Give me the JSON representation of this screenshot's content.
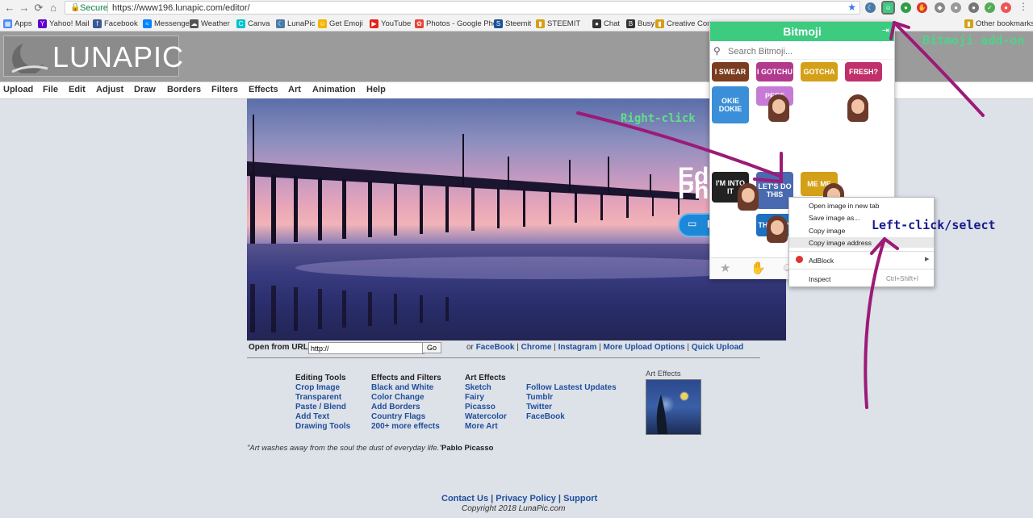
{
  "browser": {
    "nav": {
      "back": "←",
      "forward": "→",
      "reload": "⟳",
      "home": "⌂"
    },
    "secure_label": "Secure",
    "url": "https://www196.lunapic.com/editor/",
    "bookmarks": [
      {
        "label": "Apps",
        "color": "#4a8af4",
        "glyph": "▦"
      },
      {
        "label": "Yahoo! Mail",
        "color": "#5f01d1",
        "glyph": "Y"
      },
      {
        "label": "Facebook",
        "color": "#3b5998",
        "glyph": "f"
      },
      {
        "label": "Messenger",
        "color": "#0084ff",
        "glyph": "≈"
      },
      {
        "label": "Weather",
        "color": "#555",
        "glyph": "☁"
      },
      {
        "label": "Canva",
        "color": "#00c4cc",
        "glyph": "C"
      },
      {
        "label": "LunaPic",
        "color": "#4a7aa8",
        "glyph": "☾"
      },
      {
        "label": "Get Emoji",
        "color": "#f4b400",
        "glyph": "☺"
      },
      {
        "label": "YouTube",
        "color": "#e62117",
        "glyph": "▶"
      },
      {
        "label": "Photos - Google Pho",
        "color": "#ea4335",
        "glyph": "✿"
      },
      {
        "label": "Steemit",
        "color": "#1a5099",
        "glyph": "S"
      },
      {
        "label": "STEEMIT",
        "color": "#d4a017",
        "glyph": "▮"
      },
      {
        "label": "Chat",
        "color": "#333",
        "glyph": "●"
      },
      {
        "label": "Busy",
        "color": "#333",
        "glyph": "B"
      },
      {
        "label": "Creative Commons",
        "color": "#d4a017",
        "glyph": "▮"
      }
    ],
    "other_bookmarks": "Other bookmarks"
  },
  "site": {
    "logo": "LUNAPIC",
    "menu": [
      "Upload",
      "File",
      "Edit",
      "Adjust",
      "Draw",
      "Borders",
      "Filters",
      "Effects",
      "Art",
      "Animation",
      "Help"
    ],
    "hero_text_1": "Ed",
    "hero_text_2": "Ph",
    "hero_button": "E",
    "open_url_label": "Open from URL:",
    "url_value": "http://",
    "go_button": "Go",
    "upload_or": "or",
    "upload_links": [
      "FaceBook",
      "Chrome",
      "Instagram",
      "More Upload Options",
      "Quick Upload"
    ],
    "col1": {
      "title": "Editing Tools",
      "items": [
        "Crop Image",
        "Transparent",
        "Paste / Blend",
        "Add Text",
        "Drawing Tools"
      ]
    },
    "col2": {
      "title": "Effects and Filters",
      "items": [
        "Black and White",
        "Color Change",
        "Add Borders",
        "Country Flags",
        "200+ more effects"
      ]
    },
    "col3": {
      "title": "Art Effects",
      "items": [
        "Sketch",
        "Fairy",
        "Picasso",
        "Watercolor",
        "More Art"
      ]
    },
    "col4": {
      "items": [
        "Follow Lastest Updates",
        "Tumblr",
        "Twitter",
        "FaceBook"
      ]
    },
    "art_thumb_label": "Art Effects",
    "quote": "\"Art washes away from the soul the dust of everyday life.\"",
    "quote_author": "Pablo Picasso",
    "footer_links": [
      "Contact Us",
      "Privacy Policy",
      "Support"
    ],
    "copyright": "Copyright 2018 LunaPic.com"
  },
  "bitmoji": {
    "title": "Bitmoji",
    "search_placeholder": "Search Bitmoji...",
    "stickers": [
      "I SWEAR",
      "I GOTCHU",
      "GOTCHA",
      "FRESH?",
      "OKIE DOKIE",
      "PERF",
      "I'M INTO IT",
      "LET'S DO THIS",
      "ME ME",
      "THIS DAY"
    ]
  },
  "context_menu": {
    "items": [
      "Open image in new tab",
      "Save image as...",
      "Copy image",
      "Copy image address",
      "AdBlock",
      "Inspect"
    ],
    "shortcut": "Ctrl+Shift+I"
  },
  "annotations": {
    "bitmoji_addon": "Bitmoji add-on",
    "right_click": "Right-click",
    "left_click": "Left-click/select"
  },
  "colors": {
    "bitmoji_green": "#3ccb7f",
    "annotation_purple": "#9c1a78",
    "link_blue": "#1f4e9c"
  }
}
